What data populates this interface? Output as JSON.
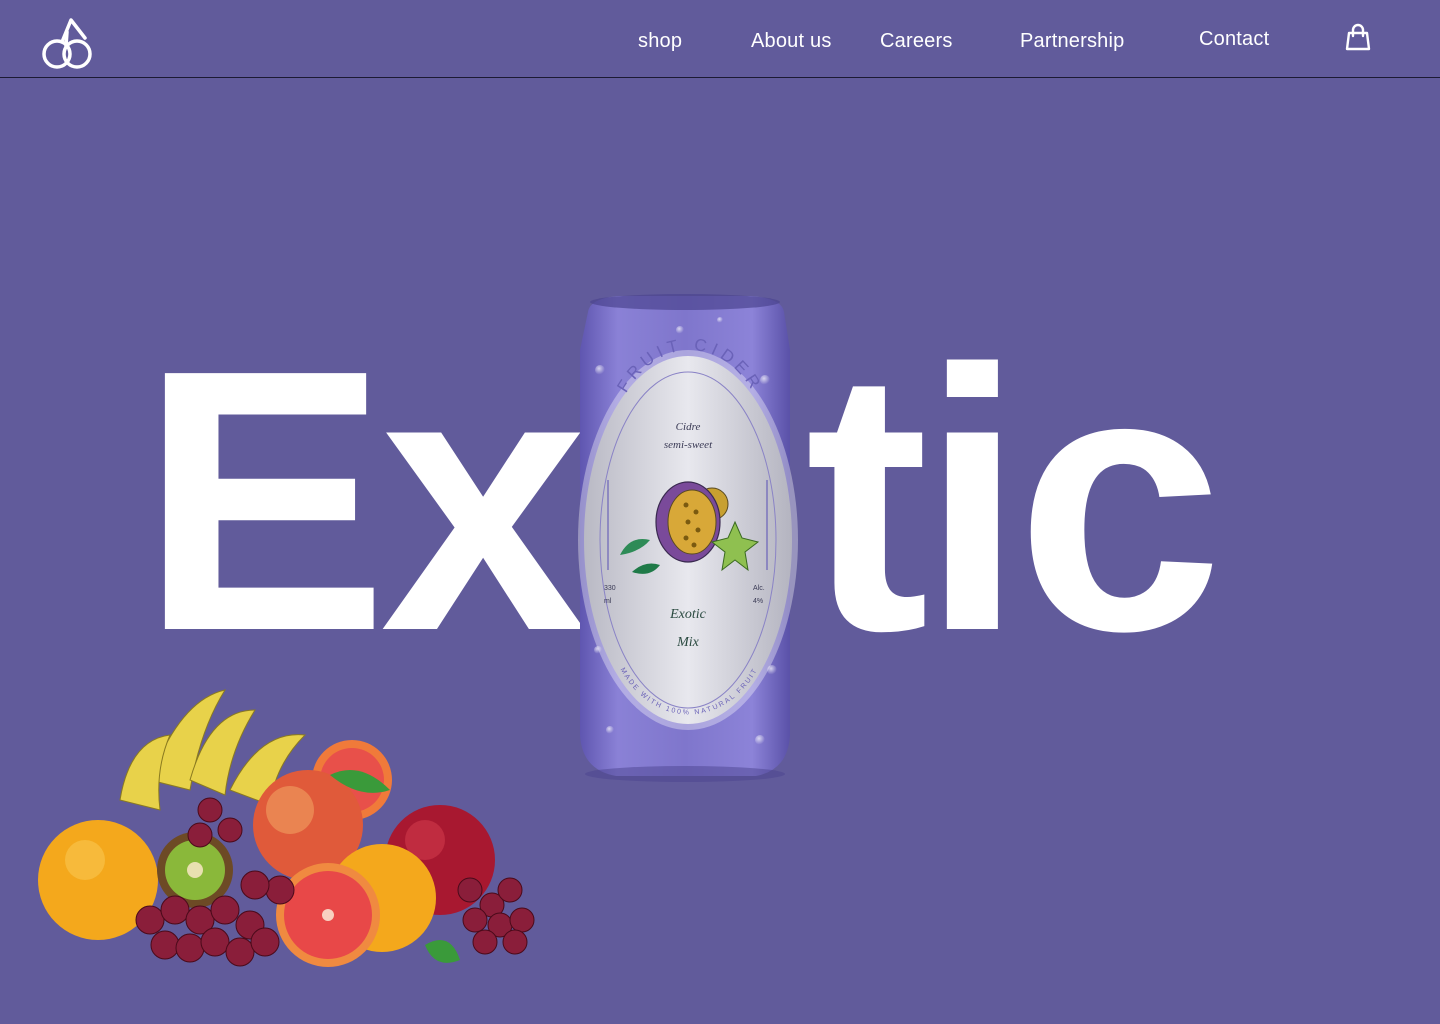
{
  "nav": {
    "logo_icon": "cherry-logo-icon",
    "links": [
      {
        "label": "shop"
      },
      {
        "label": "About us"
      },
      {
        "label": "Careers"
      },
      {
        "label": "Partnership"
      },
      {
        "label": "Contact"
      }
    ],
    "cart_icon": "shopping-bag-icon"
  },
  "hero": {
    "word_left": "Ex",
    "word_right": "tic"
  },
  "can": {
    "brand": "FRUIT CIDER",
    "subtitle_line1": "Cidre",
    "subtitle_line2": "semi-sweet",
    "volume_value": "330",
    "volume_unit": "ml",
    "alc_label": "Alc.",
    "alc_value": "4%",
    "flavor_line1": "Exotic",
    "flavor_line2": "Mix",
    "footer": "MADE WITH 100% NATURAL FRUIT"
  },
  "colors": {
    "background": "#615b9b",
    "text": "#ffffff",
    "can": "#7d74c9",
    "label": "#d9d9e0"
  }
}
